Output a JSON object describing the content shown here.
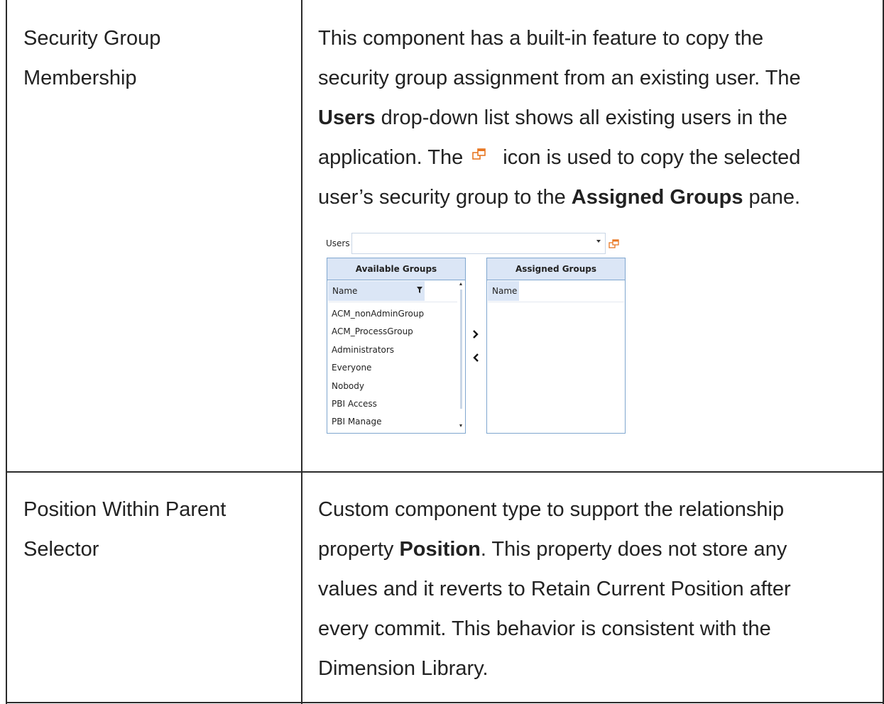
{
  "rows": [
    {
      "name_line1": "Security Group",
      "name_line2": "Membership",
      "desc": {
        "l1": "This component has a built-in feature to copy the",
        "l2": "security group assignment from an existing user. The",
        "l3_bold": "Users",
        "l3_rest": " drop-down list shows all existing users in the",
        "l4_before": "application. The ",
        "l4_after": "icon is used to copy the selected",
        "l5_before": "user’s security group to the ",
        "l5_bold": "Assigned Groups",
        "l5_after": " pane."
      }
    },
    {
      "name_line1": "Position Within Parent",
      "name_line2": "Selector",
      "desc": {
        "l1": "Custom component type to support the relationship",
        "l2_before": "property ",
        "l2_bold": "Position",
        "l2_after": ". This property does not store any",
        "l3": "values and it reverts to Retain Current Position after",
        "l4": "every commit. This behavior is consistent with the",
        "l5": "Dimension Library."
      }
    }
  ],
  "screenshot": {
    "users_label": "Users",
    "users_value": "",
    "available_title": "Available Groups",
    "assigned_title": "Assigned Groups",
    "column_name": "Name",
    "available_items": [
      "ACM_nonAdminGroup",
      "ACM_ProcessGroup",
      "Administrators",
      "Everyone",
      "Nobody",
      "PBI Access",
      "PBI Manage"
    ],
    "assigned_items": []
  },
  "icons": {
    "copy": "copy-icon",
    "filter": "filter-icon",
    "dropdown": "chevron-down-icon",
    "move_right": "chevron-right-icon",
    "move_left": "chevron-left-icon"
  },
  "colors": {
    "pane_border": "#7fa6cf",
    "pane_header": "#dbe6f6",
    "copy_icon": "#e87722"
  }
}
